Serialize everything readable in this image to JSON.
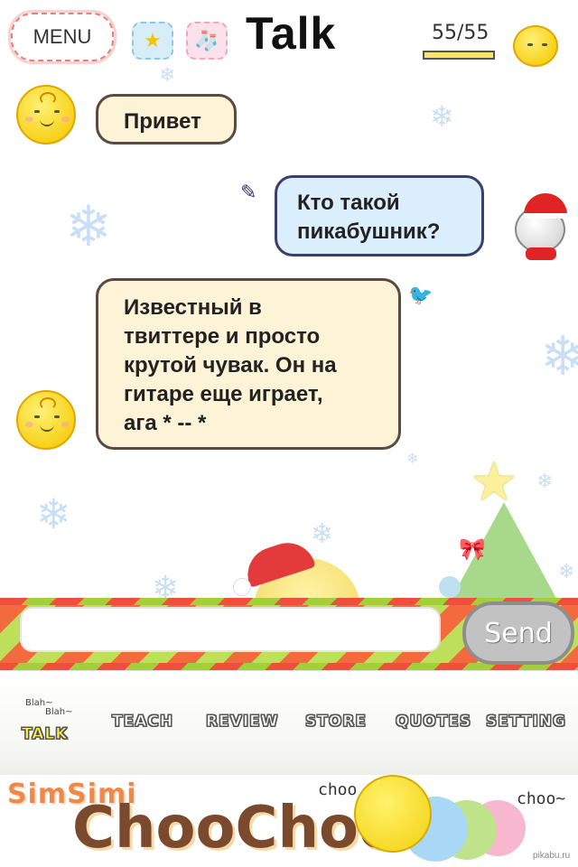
{
  "header": {
    "menu_label": "MENU",
    "title": "Talk",
    "level_text": "55/55",
    "level_fraction": 1.0,
    "icons": [
      "star-icon",
      "stocking-icon",
      "chick-avatar-icon"
    ]
  },
  "chat": {
    "messages": [
      {
        "from": "simsimi",
        "text": "Привет"
      },
      {
        "from": "user",
        "text": "Кто такой пикабушник?"
      },
      {
        "from": "simsimi",
        "text": "Известный в твиттере и просто крутой чувак. Он на гитаре еще играет, ага  * -- *"
      }
    ],
    "line_breaks": {
      "m2": [
        "Кто такой",
        "пикабушник?"
      ],
      "m3": [
        "Известный в",
        "твиттере и просто",
        "крутой чувак. Он на",
        "гитаре еще играет,",
        "ага  * -- *"
      ]
    }
  },
  "input": {
    "value": "",
    "send_label": "Send"
  },
  "tabs": {
    "blah1": "Blah~",
    "blah2": "Blah~",
    "items": [
      {
        "label": "TALK",
        "active": true
      },
      {
        "label": "TEACH",
        "active": false
      },
      {
        "label": "REVIEW",
        "active": false
      },
      {
        "label": "STORE",
        "active": false
      },
      {
        "label": "QUOTES",
        "active": false
      },
      {
        "label": "SETTING",
        "active": false
      }
    ]
  },
  "banner": {
    "brand": "SimSimi",
    "title": "ChooChoo",
    "choo1": "choo",
    "choo2": "choo~",
    "watermark": "pikabu.ru"
  },
  "colors": {
    "bubble_yellow": "#fdf3d6",
    "bubble_blue": "#dbeefc",
    "strip_red": "#ef4f3c",
    "strip_green": "#a4cf38",
    "send_gray": "#c2c2c2"
  }
}
